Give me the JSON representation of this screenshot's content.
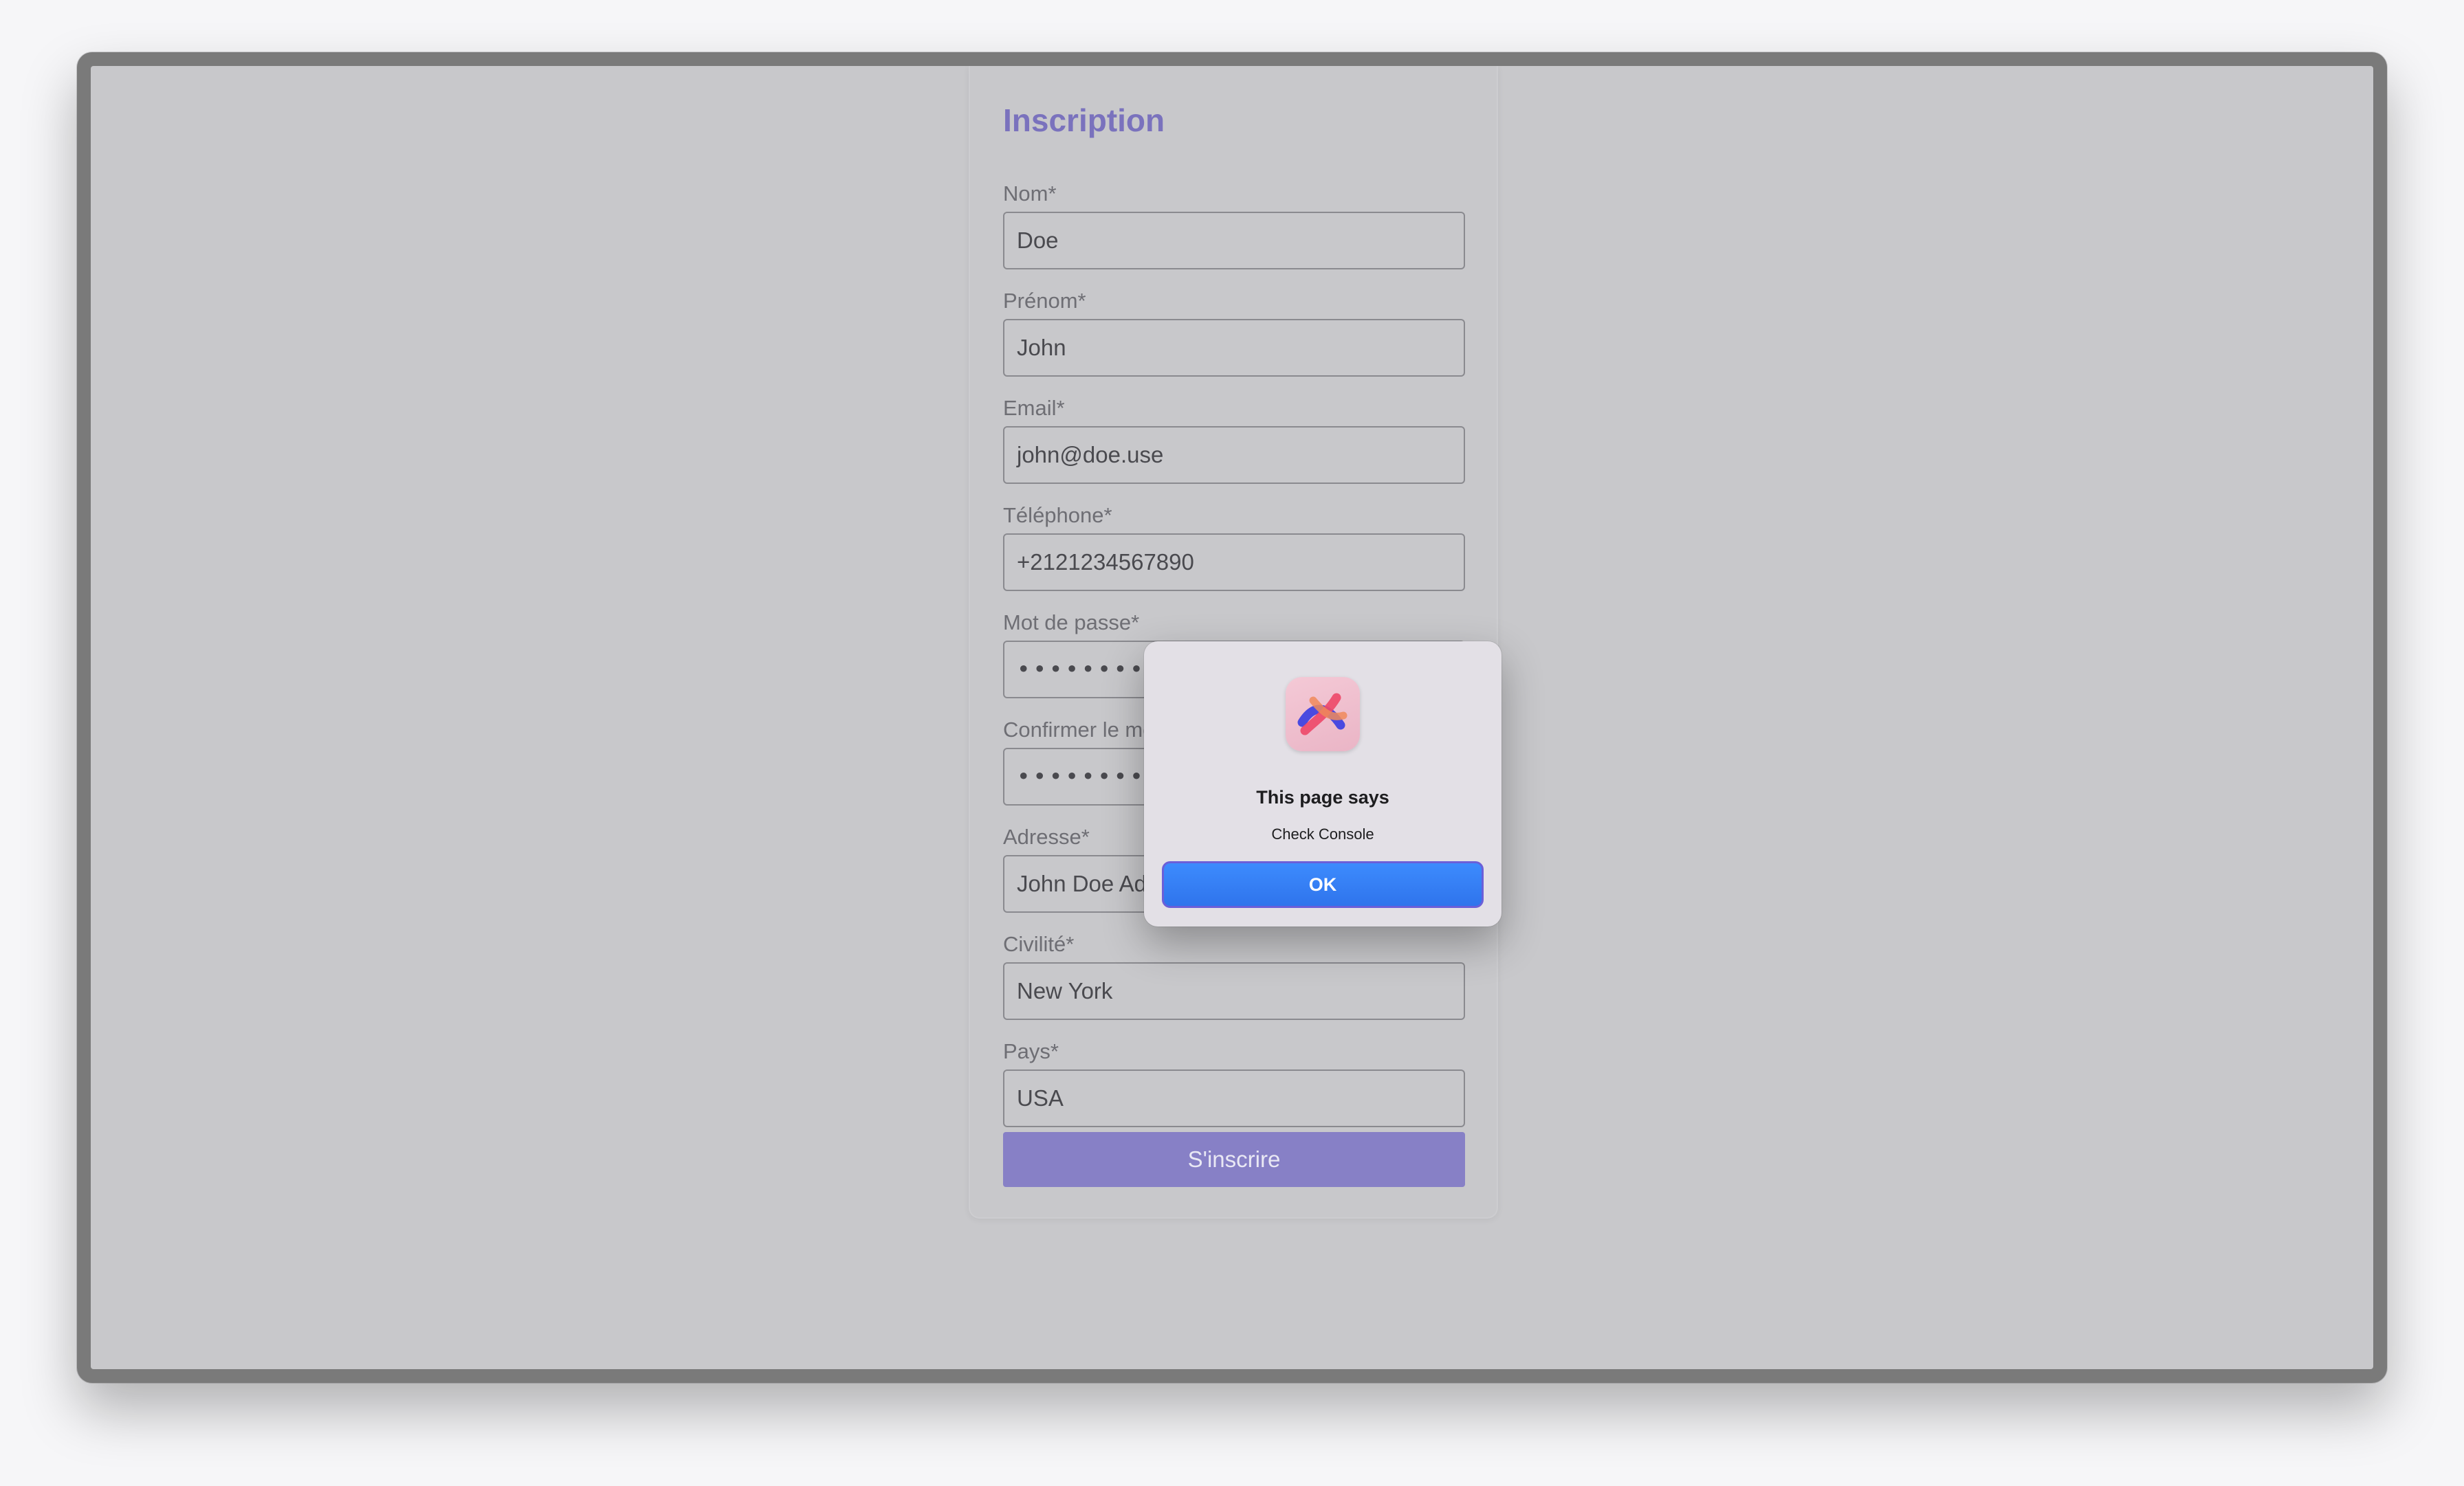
{
  "form": {
    "title": "Inscription",
    "fields": [
      {
        "label": "Nom*",
        "value": "Doe"
      },
      {
        "label": "Prénom*",
        "value": "John"
      },
      {
        "label": "Email*",
        "value": "john@doe.use"
      },
      {
        "label": "Téléphone*",
        "value": "+2121234567890"
      },
      {
        "label": "Mot de passe*",
        "value": "••••••••"
      },
      {
        "label": "Confirmer le mot de passe*",
        "value": "••••••••"
      },
      {
        "label": "Adresse*",
        "value": "John Doe Adress"
      },
      {
        "label": "Civilité*",
        "value": "New York"
      },
      {
        "label": "Pays*",
        "value": "USA"
      }
    ],
    "submit_label": "S'inscrire"
  },
  "dialog": {
    "title": "This page says",
    "message": "Check Console",
    "ok_label": "OK",
    "icon": "browser-app-icon"
  },
  "colors": {
    "title": "#7a72bd",
    "submit": "#8780c6",
    "ok_button": "#3d8bfd"
  }
}
